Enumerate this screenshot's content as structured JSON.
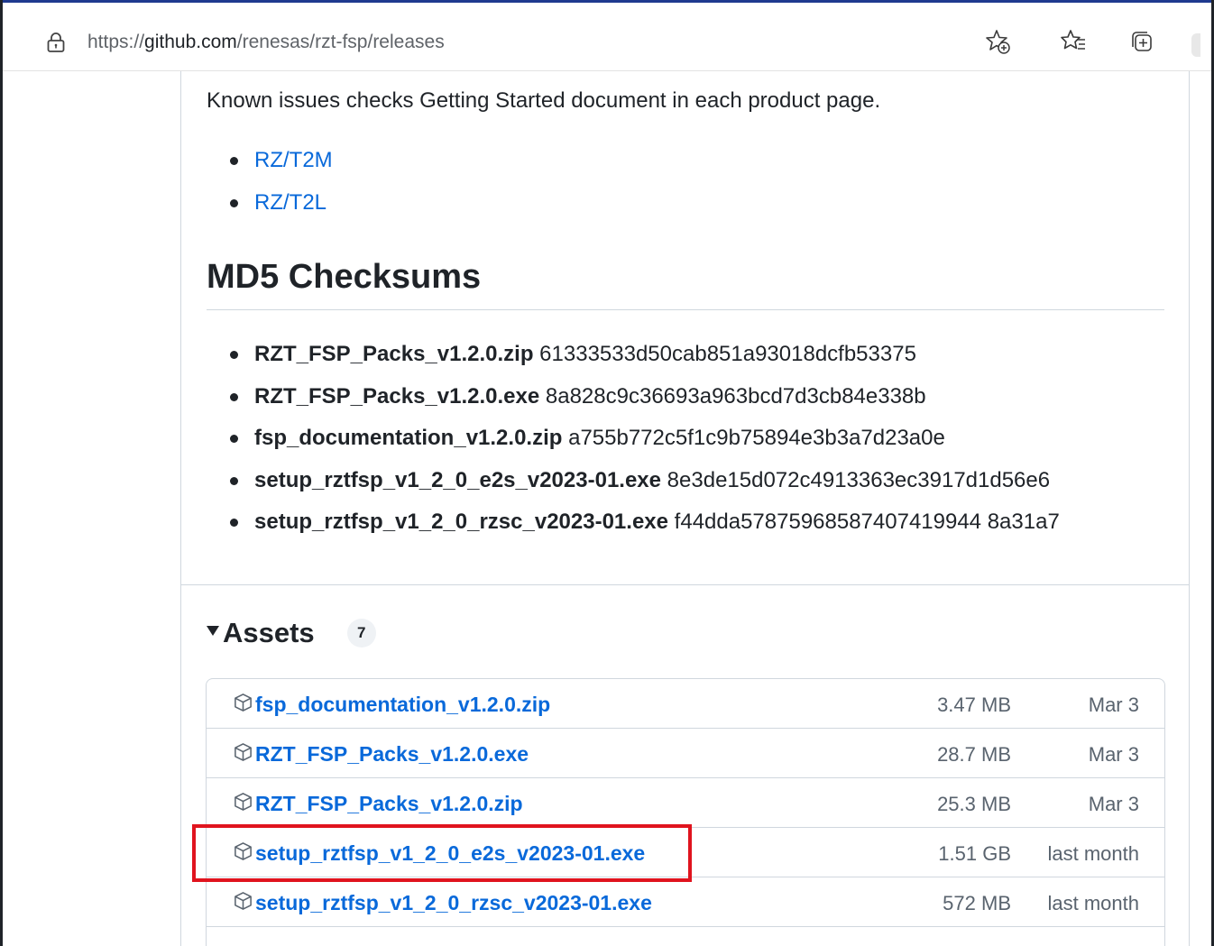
{
  "browser": {
    "url_scheme": "https://",
    "url_host": "github.com",
    "url_path": "/renesas/rzt-fsp/releases"
  },
  "release": {
    "known_issues_text": "Known issues checks Getting Started document in each product page.",
    "products": [
      {
        "label": "RZ/T2M"
      },
      {
        "label": "RZ/T2L"
      }
    ],
    "md5_heading": "MD5 Checksums",
    "checksums": [
      {
        "file": "RZT_FSP_Packs_v1.2.0.zip",
        "hash": "61333533d50cab851a93018dcfb53375"
      },
      {
        "file": "RZT_FSP_Packs_v1.2.0.exe",
        "hash": "8a828c9c36693a963bcd7d3cb84e338b"
      },
      {
        "file": "fsp_documentation_v1.2.0.zip",
        "hash": "a755b772c5f1c9b75894e3b3a7d23a0e"
      },
      {
        "file": "setup_rztfsp_v1_2_0_e2s_v2023-01.exe",
        "hash": "8e3de15d072c4913363ec3917d1d56e6"
      },
      {
        "file": "setup_rztfsp_v1_2_0_rzsc_v2023-01.exe",
        "hash": "f44dda57875968587407419944 8a31a7"
      }
    ]
  },
  "assets": {
    "title": "Assets",
    "count": "7",
    "items": [
      {
        "name": "fsp_documentation_v1.2.0.zip",
        "size": "3.47 MB",
        "date": "Mar 3"
      },
      {
        "name": "RZT_FSP_Packs_v1.2.0.exe",
        "size": "28.7 MB",
        "date": "Mar 3"
      },
      {
        "name": "RZT_FSP_Packs_v1.2.0.zip",
        "size": "25.3 MB",
        "date": "Mar 3"
      },
      {
        "name": "setup_rztfsp_v1_2_0_e2s_v2023-01.exe",
        "size": "1.51 GB",
        "date": "last month"
      },
      {
        "name": "setup_rztfsp_v1_2_0_rzsc_v2023-01.exe",
        "size": "572 MB",
        "date": "last month"
      }
    ]
  },
  "colors": {
    "link": "#0969da",
    "text": "#1f2328",
    "muted": "#59636e",
    "border": "#d0d7de",
    "highlight": "#e0141e"
  },
  "icons": {
    "site_info": "lock-icon",
    "favorite_add": "star-plus-icon",
    "favorites": "favorites-list-icon",
    "collections": "collections-icon",
    "asset": "package-icon",
    "toggle": "caret-down-icon"
  }
}
